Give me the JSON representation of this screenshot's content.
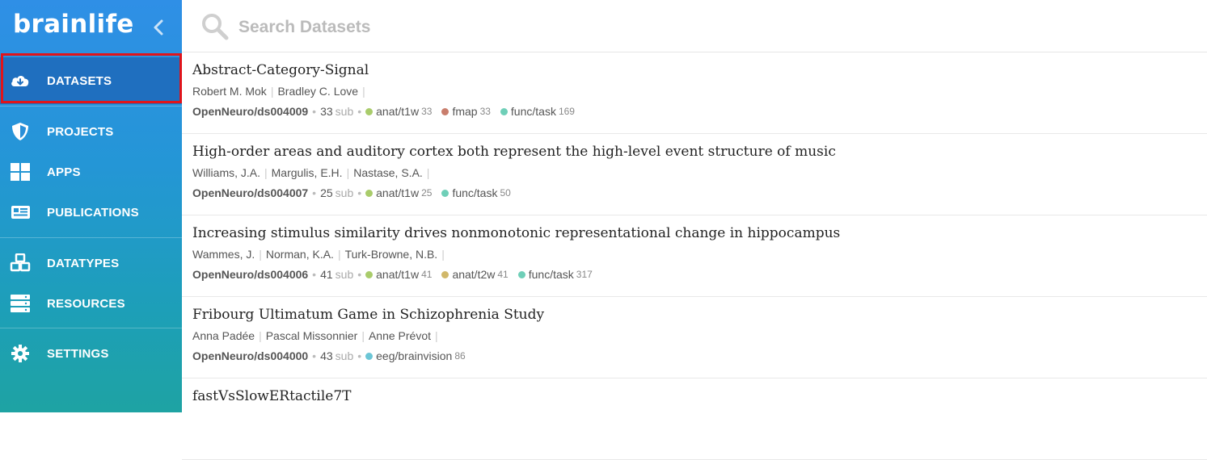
{
  "app": {
    "logo": "brainlife"
  },
  "sidebar": {
    "items": [
      {
        "label": "DATASETS",
        "icon": "cloud-download-icon",
        "active": true
      },
      {
        "label": "PROJECTS",
        "icon": "shield-icon"
      },
      {
        "label": "APPS",
        "icon": "grid-icon"
      },
      {
        "label": "PUBLICATIONS",
        "icon": "newspaper-icon"
      },
      {
        "label": "DATATYPES",
        "icon": "cubes-icon"
      },
      {
        "label": "RESOURCES",
        "icon": "server-icon"
      },
      {
        "label": "SETTINGS",
        "icon": "gear-icon"
      }
    ]
  },
  "search": {
    "placeholder": "Search Datasets",
    "value": ""
  },
  "datasets": [
    {
      "title": "Abstract-Category-Signal",
      "authors": [
        "Robert M. Mok",
        "Bradley C. Love"
      ],
      "source": "OpenNeuro/ds004009",
      "subjects": "33",
      "sub_label": "sub",
      "datatypes": [
        {
          "name": "anat/t1w",
          "count": "33",
          "color": "#a9cc6b"
        },
        {
          "name": "fmap",
          "count": "33",
          "color": "#c97e6d"
        },
        {
          "name": "func/task",
          "count": "169",
          "color": "#6fcfb8"
        }
      ]
    },
    {
      "title": "High-order areas and auditory cortex both represent the high-level event structure of music",
      "authors": [
        "Williams, J.A.",
        "Margulis, E.H.",
        "Nastase, S.A."
      ],
      "source": "OpenNeuro/ds004007",
      "subjects": "25",
      "sub_label": "sub",
      "datatypes": [
        {
          "name": "anat/t1w",
          "count": "25",
          "color": "#a9cc6b"
        },
        {
          "name": "func/task",
          "count": "50",
          "color": "#6fcfb8"
        }
      ]
    },
    {
      "title": "Increasing stimulus similarity drives nonmonotonic representational change in hippocampus",
      "authors": [
        "Wammes, J.",
        "Norman, K.A.",
        "Turk-Browne, N.B."
      ],
      "source": "OpenNeuro/ds004006",
      "subjects": "41",
      "sub_label": "sub",
      "datatypes": [
        {
          "name": "anat/t1w",
          "count": "41",
          "color": "#a9cc6b"
        },
        {
          "name": "anat/t2w",
          "count": "41",
          "color": "#d1b86a"
        },
        {
          "name": "func/task",
          "count": "317",
          "color": "#6fcfb8"
        }
      ]
    },
    {
      "title": "Fribourg Ultimatum Game in Schizophrenia Study",
      "authors": [
        "Anna Padée",
        "Pascal Missonnier",
        "Anne Prévot"
      ],
      "source": "OpenNeuro/ds004000",
      "subjects": "43",
      "sub_label": "sub",
      "datatypes": [
        {
          "name": "eeg/brainvision",
          "count": "86",
          "color": "#6cc6d6"
        }
      ]
    },
    {
      "title": "fastVsSlowERtactile7T",
      "authors": [],
      "source": "",
      "subjects": "",
      "sub_label": "",
      "datatypes": []
    }
  ]
}
